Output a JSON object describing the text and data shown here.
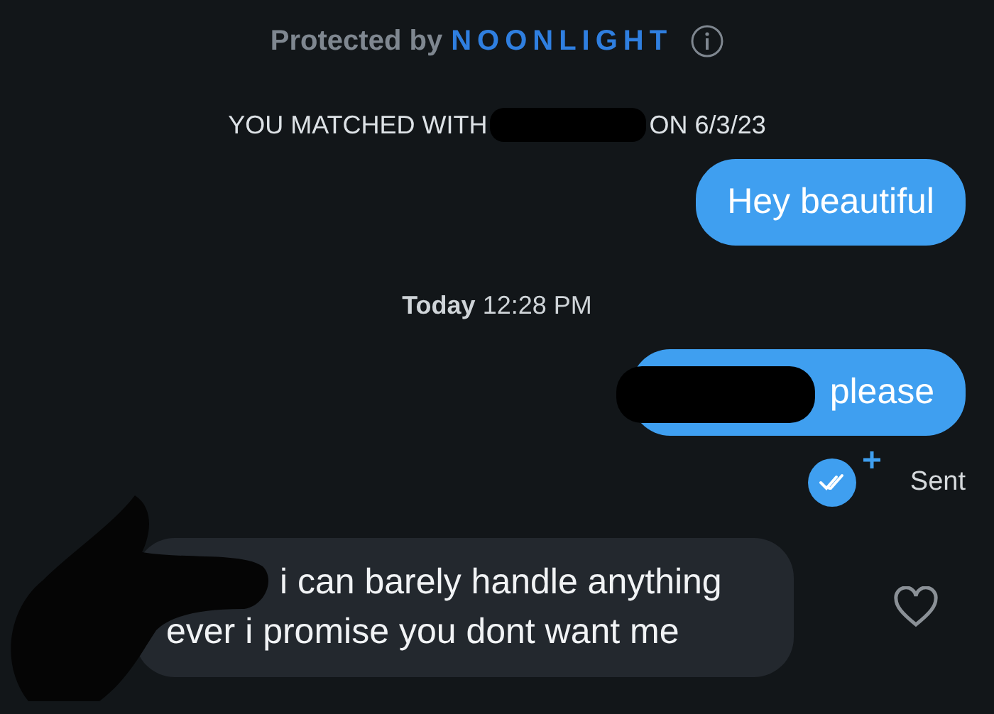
{
  "header": {
    "prefix": "Protected by",
    "brand": "NOONLIGHT"
  },
  "match_notice": {
    "before": "YOU MATCHED WITH",
    "after": "ON 6/3/23"
  },
  "messages": [
    {
      "kind": "outgoing",
      "text": "Hey beautiful",
      "redacted": false
    },
    {
      "kind": "timestamp",
      "day": "Today",
      "time": "12:28 PM"
    },
    {
      "kind": "outgoing",
      "text": "please",
      "redacted": true,
      "status": "Sent"
    },
    {
      "kind": "incoming",
      "text": "i can barely handle anything ever i promise you dont want me",
      "redacted": true
    }
  ]
}
